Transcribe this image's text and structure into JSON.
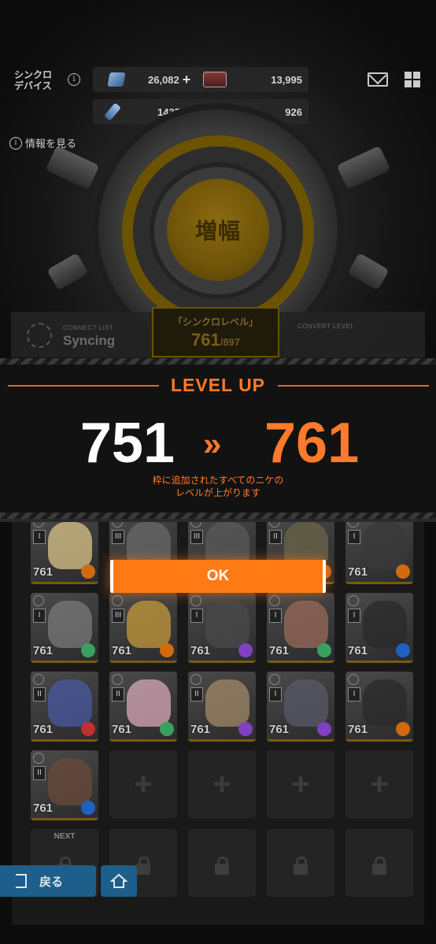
{
  "header": {
    "sync_device_label": "シンクロ\nデバイス",
    "info_link": "情報を見る",
    "resources": [
      {
        "icon": "crystal-gem-icon",
        "value": "26,082"
      },
      {
        "icon": "ticket-icon",
        "value": "13,995"
      },
      {
        "icon": "battery-icon",
        "value": "1435 K"
      },
      {
        "icon": "core-orb-icon",
        "value": "926"
      }
    ],
    "plus": "+"
  },
  "machine": {
    "core_label": "増幅"
  },
  "connect": {
    "left_small": "CONNECT LIST",
    "left_big": "Syncing",
    "right_small": "CONVERT LEVEL",
    "sync_title": "「シンクロレベル」",
    "sync_level": "761",
    "sync_max": "/897"
  },
  "levelup": {
    "title": "LEVEL UP",
    "old_level": "751",
    "arrow": "»",
    "new_level": "761",
    "description_line1": "枠に追加されたすべてのニケの",
    "description_line2": "レベルが上がります",
    "ok_label": "OK"
  },
  "grid": {
    "level": "761",
    "characters": [
      {
        "rank": "I",
        "face": "#d9c48a",
        "elem": "#d06a10"
      },
      {
        "rank": "III",
        "face": "#6a6a6a",
        "elem": "#3aa060"
      },
      {
        "rank": "III",
        "face": "#5a5a5a",
        "elem": "#8040c0"
      },
      {
        "rank": "II",
        "face": "#6b6448",
        "elem": "#d06a10"
      },
      {
        "rank": "I",
        "face": "#3a3a3a",
        "elem": "#d06a10"
      },
      {
        "rank": "I",
        "face": "#7a7a7a",
        "elem": "#3aa060"
      },
      {
        "rank": "III",
        "face": "#c49a3a",
        "elem": "#d06a10"
      },
      {
        "rank": "I",
        "face": "#4a4a4a",
        "elem": "#8040c0"
      },
      {
        "rank": "I",
        "face": "#9a6a5a",
        "elem": "#3aa060"
      },
      {
        "rank": "I",
        "face": "#2a2a2a",
        "elem": "#2060c0"
      },
      {
        "rank": "II",
        "face": "#4a5aa0",
        "elem": "#c03030"
      },
      {
        "rank": "II",
        "face": "#d8a8b8",
        "elem": "#3aa060"
      },
      {
        "rank": "II",
        "face": "#a08868",
        "elem": "#8040c0"
      },
      {
        "rank": "I",
        "face": "#5a5a6a",
        "elem": "#8040c0"
      },
      {
        "rank": "I",
        "face": "#2a2a2a",
        "elem": "#d06a10"
      },
      {
        "rank": "II",
        "face": "#6a4a3a",
        "elem": "#2060c0"
      }
    ],
    "plus_glyph": "+",
    "next_label": "NEXT"
  },
  "nav": {
    "back_label": "戻る"
  },
  "colors": {
    "accent_orange": "#ff7a2a",
    "nav_blue": "#1d5e8a"
  }
}
